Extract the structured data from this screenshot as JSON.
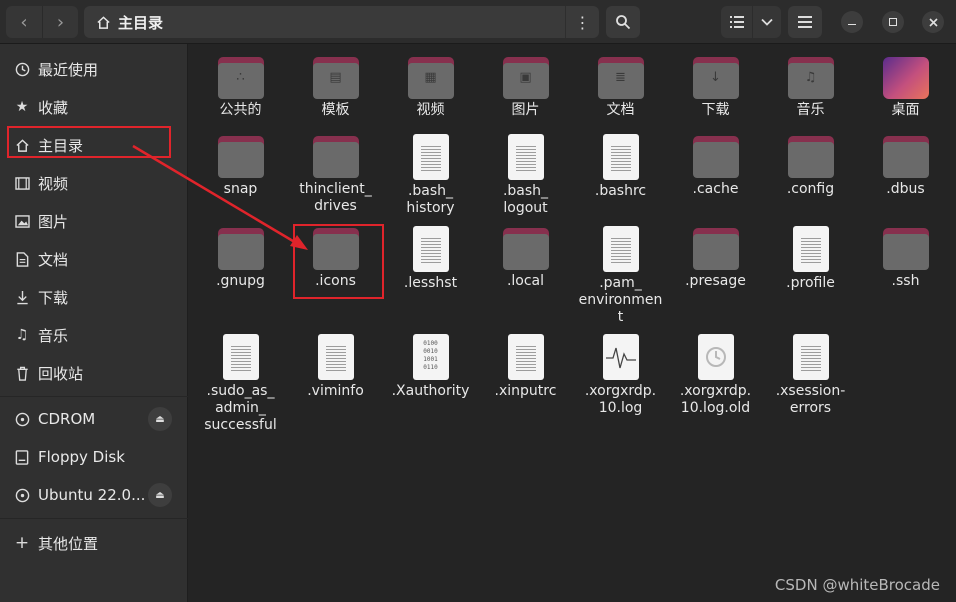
{
  "header": {
    "title": "主目录",
    "back_icon": "chevron-left-icon",
    "forward_icon": "chevron-right-icon"
  },
  "sidebar": {
    "items": [
      {
        "label": "最近使用",
        "icon": "clock-icon"
      },
      {
        "label": "收藏",
        "icon": "star-icon"
      },
      {
        "label": "主目录",
        "icon": "home-icon"
      },
      {
        "label": "视频",
        "icon": "film-icon"
      },
      {
        "label": "图片",
        "icon": "image-icon"
      },
      {
        "label": "文档",
        "icon": "document-icon"
      },
      {
        "label": "下载",
        "icon": "download-icon"
      },
      {
        "label": "音乐",
        "icon": "music-icon"
      },
      {
        "label": "回收站",
        "icon": "trash-icon"
      }
    ],
    "devices": [
      {
        "label": "CDROM",
        "icon": "disc-icon"
      },
      {
        "label": "Floppy Disk",
        "icon": "drive-icon"
      },
      {
        "label": "Ubuntu 22.0...",
        "icon": "disc-icon"
      }
    ],
    "other": {
      "label": "其他位置",
      "icon": "plus-icon"
    }
  },
  "files": [
    {
      "name": "公共的",
      "kind": "folder",
      "glyph": "share-icon"
    },
    {
      "name": "模板",
      "kind": "folder",
      "glyph": "template-icon"
    },
    {
      "name": "视频",
      "kind": "folder",
      "glyph": "film-icon"
    },
    {
      "name": "图片",
      "kind": "folder",
      "glyph": "image-icon"
    },
    {
      "name": "文档",
      "kind": "folder",
      "glyph": "document-icon"
    },
    {
      "name": "下载",
      "kind": "folder",
      "glyph": "download-icon"
    },
    {
      "name": "音乐",
      "kind": "folder",
      "glyph": "music-icon"
    },
    {
      "name": "桌面",
      "kind": "desktop"
    },
    {
      "name": "snap",
      "kind": "folder"
    },
    {
      "name": "thinclient_\ndrives",
      "kind": "folder"
    },
    {
      "name": ".bash_\nhistory",
      "kind": "text"
    },
    {
      "name": ".bash_\nlogout",
      "kind": "text"
    },
    {
      "name": ".bashrc",
      "kind": "text"
    },
    {
      "name": ".cache",
      "kind": "folder"
    },
    {
      "name": ".config",
      "kind": "folder"
    },
    {
      "name": ".dbus",
      "kind": "folder"
    },
    {
      "name": ".gnupg",
      "kind": "folder"
    },
    {
      "name": ".icons",
      "kind": "folder"
    },
    {
      "name": ".lesshst",
      "kind": "text"
    },
    {
      "name": ".local",
      "kind": "folder"
    },
    {
      "name": ".pam_\nenvironmen\nt",
      "kind": "text"
    },
    {
      "name": ".presage",
      "kind": "folder"
    },
    {
      "name": ".profile",
      "kind": "text"
    },
    {
      "name": ".ssh",
      "kind": "folder"
    },
    {
      "name": ".sudo_as_\nadmin_\nsuccessful",
      "kind": "text"
    },
    {
      "name": ".viminfo",
      "kind": "text"
    },
    {
      "name": ".Xauthority",
      "kind": "binary"
    },
    {
      "name": ".xinputrc",
      "kind": "text"
    },
    {
      "name": ".xorgxrdp.\n10.log",
      "kind": "log"
    },
    {
      "name": ".xorgxrdp.\n10.log.old",
      "kind": "backup"
    },
    {
      "name": ".xsession-\nerrors",
      "kind": "text"
    }
  ],
  "binary_glyph": "0100\n0010\n1001\n0110",
  "annotation_color": "#e0242b",
  "watermark": "CSDN @whiteBrocade"
}
